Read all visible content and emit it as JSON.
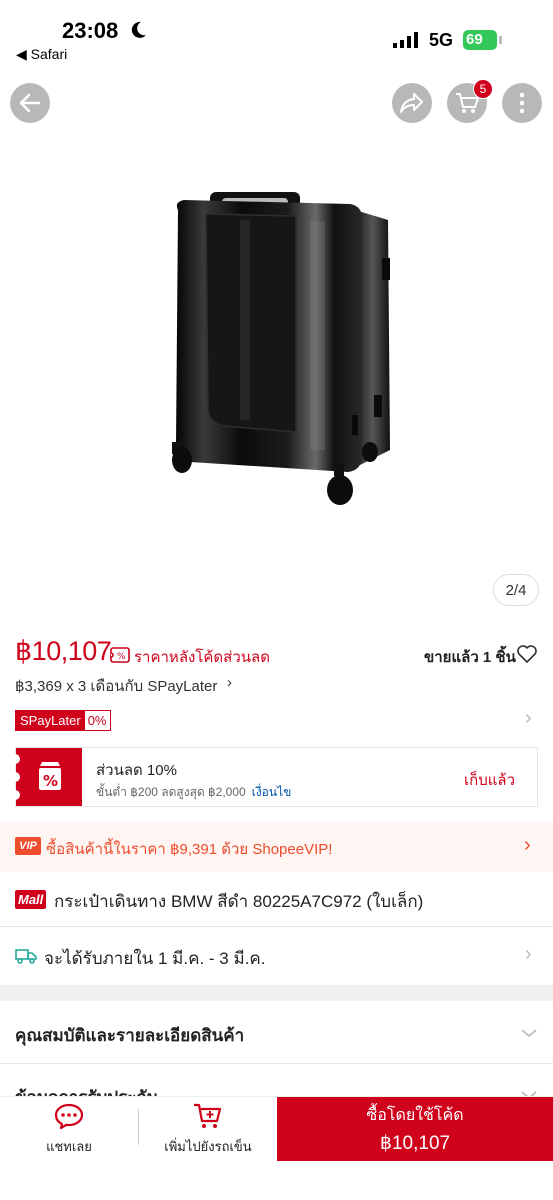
{
  "status_bar": {
    "time": "23:08",
    "back_app": "◀ Safari",
    "network": "5G",
    "battery": "69"
  },
  "nav": {
    "cart_count": "5"
  },
  "gallery": {
    "counter": "2/4"
  },
  "price": {
    "amount": "฿10,107",
    "note": "ราคาหลังโค้ดส่วนลด",
    "sold": "ขายแล้ว 1 ชิ้น",
    "installment": "฿3,369 x 3 เดือนกับ SPayLater",
    "installment_chev": "›"
  },
  "spaylater": {
    "label": "SPayLater",
    "rate": "0%",
    "chev": "›"
  },
  "voucher": {
    "title": "ส่วนลด 10%",
    "detail": "ขั้นต่ำ ฿200 ลดสูงสุด ฿2,000",
    "condition": "เงื่อนไข",
    "claim": "เก็บแล้ว"
  },
  "vip": {
    "badge": "VIP",
    "text": "ซื้อสินค้านี้ในราคา ฿9,391 ด้วย ShopeeVIP!",
    "chev": "›"
  },
  "product": {
    "mall_badge": "Mall",
    "title": "กระเป๋าเดินทาง BMW สีดำ 80225A7C972 (ใบเล็ก)"
  },
  "delivery": {
    "text": "จะได้รับภายใน 1 มี.ค. - 3 มี.ค.",
    "chev": "›"
  },
  "sections": {
    "specs": "คุณสมบัติและรายละเอียดสินค้า",
    "warranty": "ข้อมูลการรับประกัน"
  },
  "bottom_bar": {
    "chat": "แชทเลย",
    "add_cart": "เพิ่มไปยังรถเข็น",
    "buy_label": "ซื้อโดยใช้โค้ด",
    "buy_price": "฿10,107"
  },
  "colors": {
    "brand_red": "#d0011b",
    "vip_orange": "#ee4d2d",
    "link_blue": "#0055aa"
  },
  "icons": [
    "moon-icon",
    "signal-icon",
    "back-arrow-icon",
    "share-icon",
    "cart-icon",
    "more-icon",
    "price-tag-icon",
    "heart-icon",
    "voucher-percent-icon",
    "truck-icon",
    "chat-icon",
    "add-cart-icon",
    "chevron-down-icon"
  ]
}
